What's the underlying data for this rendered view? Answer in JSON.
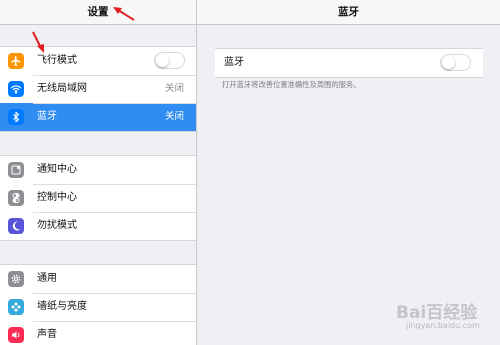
{
  "sidebar": {
    "title": "设置",
    "groups": [
      {
        "items": [
          {
            "icon": "airplane-icon",
            "label": "飞行模式",
            "control": "toggle",
            "toggle_on": false,
            "color": "#ff9500"
          },
          {
            "icon": "wifi-icon",
            "label": "无线局域网",
            "value": "关闭",
            "color": "#007aff"
          },
          {
            "icon": "bluetooth-icon",
            "label": "蓝牙",
            "value": "关闭",
            "selected": true,
            "color": "#007aff"
          }
        ]
      },
      {
        "items": [
          {
            "icon": "notification-center-icon",
            "label": "通知中心",
            "color": "#8e8e93"
          },
          {
            "icon": "control-center-icon",
            "label": "控制中心",
            "color": "#8e8e93"
          },
          {
            "icon": "do-not-disturb-icon",
            "label": "勿扰模式",
            "color": "#5856d6"
          }
        ]
      },
      {
        "items": [
          {
            "icon": "gear-icon",
            "label": "通用",
            "color": "#8e8e93"
          },
          {
            "icon": "wallpaper-icon",
            "label": "墙纸与亮度",
            "color": "#34aadc"
          },
          {
            "icon": "sound-icon",
            "label": "声音",
            "color": "#ff2d55"
          }
        ]
      }
    ]
  },
  "detail": {
    "title": "蓝牙",
    "bluetooth_label": "蓝牙",
    "bluetooth_on": false,
    "footnote": "打开蓝牙将改善位置准确性及周围的服务。"
  },
  "watermark": {
    "text": "Bai百经验",
    "sub": "jingyan.baidu.com"
  },
  "colors": {
    "accent": "#2f8cf0",
    "annotation_arrow": "#e02020"
  }
}
